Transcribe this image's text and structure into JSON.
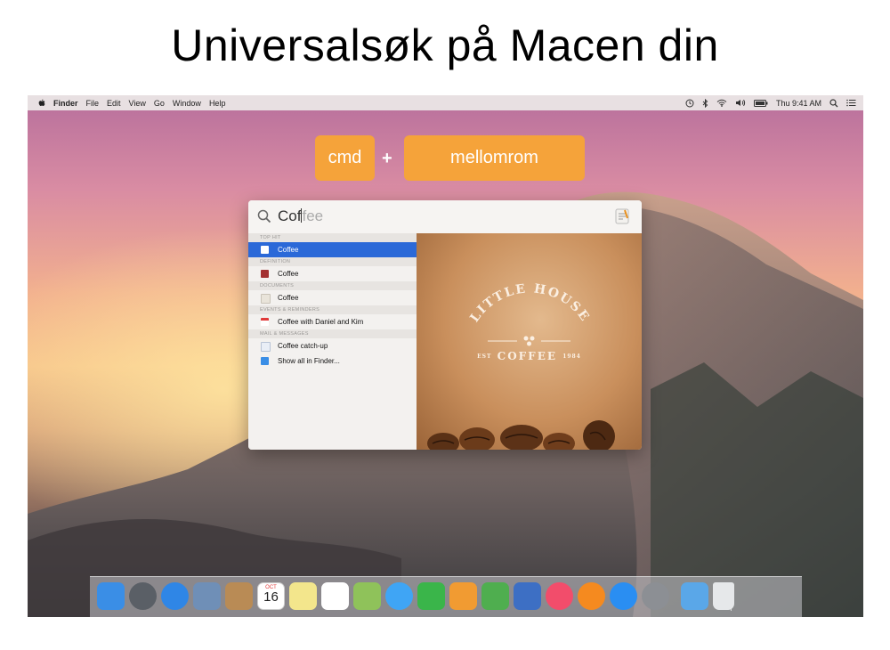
{
  "slide": {
    "title": "Universalsøk på Macen din"
  },
  "menubar": {
    "items": [
      "Finder",
      "File",
      "Edit",
      "View",
      "Go",
      "Window",
      "Help"
    ],
    "clock": "Thu 9:41 AM"
  },
  "shortcut": {
    "key1": "cmd",
    "plus": "+",
    "key2": "mellomrom"
  },
  "spotlight": {
    "query_typed": "Cof",
    "query_completion": "fee",
    "sections": [
      {
        "header": "TOP HIT",
        "rows": [
          {
            "label": "Coffee",
            "icon": "coffee-doc-icon",
            "selected": true
          }
        ]
      },
      {
        "header": "DEFINITION",
        "rows": [
          {
            "label": "Coffee",
            "icon": "dictionary-icon"
          }
        ]
      },
      {
        "header": "DOCUMENTS",
        "rows": [
          {
            "label": "Coffee",
            "icon": "document-icon"
          }
        ]
      },
      {
        "header": "EVENTS & REMINDERS",
        "rows": [
          {
            "label": "Coffee with Daniel and Kim",
            "icon": "calendar-icon"
          }
        ]
      },
      {
        "header": "MAIL & MESSAGES",
        "rows": [
          {
            "label": "Coffee catch-up",
            "icon": "mail-icon"
          }
        ]
      }
    ],
    "show_all": "Show all in Finder...",
    "preview": {
      "line1": "LITTLE HOUSE",
      "line2_left": "EST",
      "line2_main": "COFFEE",
      "line2_right": "1984"
    }
  },
  "dock": {
    "calendar_month": "OCT",
    "calendar_day": "16",
    "icons": [
      "finder-icon",
      "launchpad-icon",
      "safari-icon",
      "preview-icon",
      "contacts-icon",
      "calendar-icon",
      "notes-icon",
      "reminders-icon",
      "maps-icon",
      "messages-icon",
      "facetime-icon",
      "pages-icon",
      "numbers-icon",
      "keynote-icon",
      "itunes-icon",
      "ibooks-icon",
      "app-store-icon",
      "system-preferences-icon",
      "downloads-folder-icon",
      "trash-icon"
    ],
    "colors": [
      "#3a8ee6",
      "#5a5f66",
      "#2f86e6",
      "#6f8fb7",
      "#b98b55",
      "#ffffff",
      "#f3e68c",
      "#ffffff",
      "#8fc25a",
      "#3fa5f5",
      "#3ab54a",
      "#f19b32",
      "#4fae4f",
      "#3d6fc4",
      "#f24d6b",
      "#f58a1f",
      "#2a8ef2",
      "#8c8f94",
      "#5aa7e8",
      "#e6e8ea"
    ]
  }
}
